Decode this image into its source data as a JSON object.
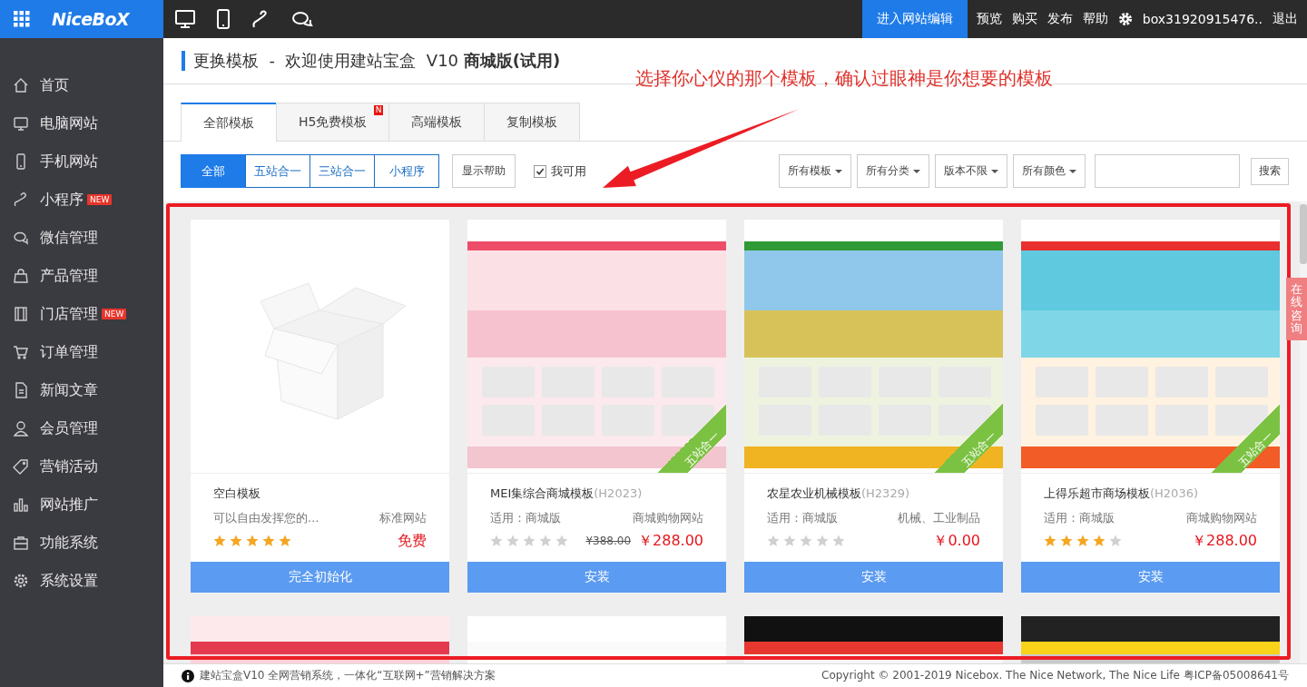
{
  "topbar": {
    "logo": "NiceBoX",
    "edit_button": "进入网站编辑",
    "links": [
      "预览",
      "购买",
      "发布",
      "帮助"
    ],
    "account": "box31920915476..",
    "logout": "退出"
  },
  "sidebar": {
    "items": [
      {
        "label": "首页"
      },
      {
        "label": "电脑网站"
      },
      {
        "label": "手机网站"
      },
      {
        "label": "小程序",
        "badge": "NEW"
      },
      {
        "label": "微信管理"
      },
      {
        "label": "产品管理"
      },
      {
        "label": "门店管理",
        "badge": "NEW"
      },
      {
        "label": "订单管理"
      },
      {
        "label": "新闻文章"
      },
      {
        "label": "会员管理"
      },
      {
        "label": "营销活动"
      },
      {
        "label": "网站推广"
      },
      {
        "label": "功能系统"
      },
      {
        "label": "系统设置"
      }
    ]
  },
  "page_header": {
    "title": "更换模板  -  欢迎使用建站宝盒  V10 **商城版(试用)**"
  },
  "annotation": {
    "text": "选择你心仪的那个模板，确认过眼神是你想要的模板"
  },
  "tabs": [
    {
      "label": "全部模板",
      "selected": true
    },
    {
      "label": "H5免费模板",
      "selected": false,
      "badge": "N"
    },
    {
      "label": "高端模板",
      "selected": false
    },
    {
      "label": "复制模板",
      "selected": false
    }
  ],
  "type_filters": [
    {
      "label": "全部",
      "selected": true
    },
    {
      "label": "五站合一",
      "selected": false
    },
    {
      "label": "三站合一",
      "selected": false
    },
    {
      "label": "小程序",
      "selected": false
    }
  ],
  "help_button": "显示帮助",
  "available_checkbox": {
    "label": "我可用",
    "checked": true
  },
  "dropdowns": [
    "所有模板",
    "所有分类",
    "版本不限",
    "所有颜色"
  ],
  "search": {
    "button": "搜索"
  },
  "templates": [
    {
      "kind": "blank",
      "name": "空白模板",
      "description": "可以自由发挥您的...",
      "category": "标准网站",
      "stars": 5,
      "price": "免费",
      "button": "完全初始化"
    },
    {
      "kind": "site",
      "name": "MEI集综合商城模板",
      "code": "(H2023)",
      "description": "适用：商城版",
      "category": "商城购物网站",
      "stars": 0,
      "old_price": "¥388.00",
      "price": "￥288.00",
      "button": "安装",
      "ribbon": "五站合一"
    },
    {
      "kind": "site",
      "name": "农星农业机械模板",
      "code": "(H2329)",
      "description": "适用：商城版",
      "category": "机械、工业制品",
      "stars": 0,
      "price": "￥0.00",
      "button": "安装",
      "ribbon": "五站合一"
    },
    {
      "kind": "site",
      "name": "上得乐超市商场模板",
      "code": "(H2036)",
      "description": "适用：商城版",
      "category": "商城购物网站",
      "stars": 4,
      "price": "￥288.00",
      "button": "安装",
      "ribbon": "五站合一"
    }
  ],
  "side_tab": "在线咨询",
  "footer": {
    "notice": "建站宝盒V10 全网营销系统，一体化“互联网+”营销解决方案",
    "copyright": "Copyright © 2001-2019 Nicebox. The Nice Network, The Nice Life 粤ICP备05008641号"
  }
}
